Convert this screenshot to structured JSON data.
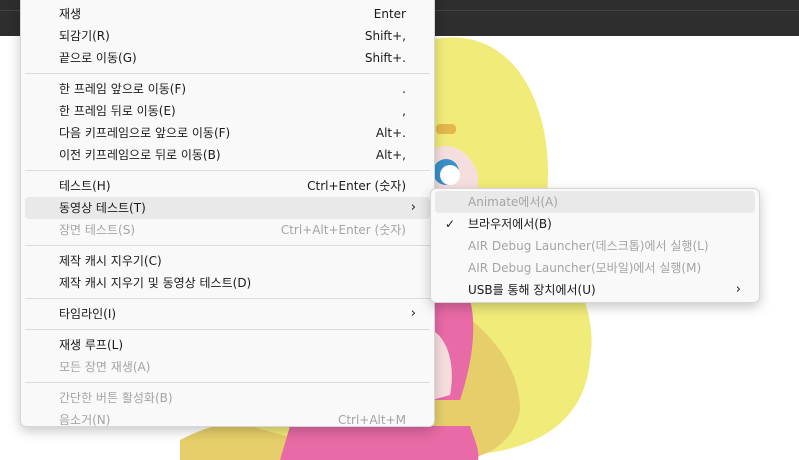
{
  "main_menu": {
    "groups": [
      [
        {
          "label": "재생",
          "shortcut": "Enter",
          "disabled": false
        },
        {
          "label": "되감기(R)",
          "shortcut": "Shift+,",
          "disabled": false
        },
        {
          "label": "끝으로 이동(G)",
          "shortcut": "Shift+.",
          "disabled": false
        }
      ],
      [
        {
          "label": "한 프레임 앞으로 이동(F)",
          "shortcut": ".",
          "disabled": false
        },
        {
          "label": "한 프레임 뒤로 이동(E)",
          "shortcut": ",",
          "disabled": false
        },
        {
          "label": "다음 키프레임으로 앞으로 이동(F)",
          "shortcut": "Alt+.",
          "disabled": false
        },
        {
          "label": "이전 키프레임으로 뒤로 이동(B)",
          "shortcut": "Alt+,",
          "disabled": false
        }
      ],
      [
        {
          "label": "테스트(H)",
          "shortcut": "Ctrl+Enter (숫자)",
          "disabled": false
        },
        {
          "label": "동영상 테스트(T)",
          "shortcut": "",
          "submenu": true,
          "active": true,
          "disabled": false
        },
        {
          "label": "장면 테스트(S)",
          "shortcut": "Ctrl+Alt+Enter (숫자)",
          "disabled": true
        }
      ],
      [
        {
          "label": "제작 캐시 지우기(C)",
          "shortcut": "",
          "disabled": false
        },
        {
          "label": "제작 캐시 지우기 및 동영상 테스트(D)",
          "shortcut": "",
          "disabled": false
        }
      ],
      [
        {
          "label": "타임라인(I)",
          "shortcut": "",
          "submenu": true,
          "disabled": false
        }
      ],
      [
        {
          "label": "재생 루프(L)",
          "shortcut": "",
          "disabled": false
        },
        {
          "label": "모든 장면 재생(A)",
          "shortcut": "",
          "disabled": true
        }
      ],
      [
        {
          "label": "간단한 버튼 활성화(B)",
          "shortcut": "",
          "disabled": true
        },
        {
          "label": "음소거(N)",
          "shortcut": "Ctrl+Alt+M",
          "disabled": true
        }
      ]
    ]
  },
  "sub_menu": {
    "items": [
      {
        "label": "Animate에서(A)",
        "disabled": true,
        "active": true,
        "checked": false
      },
      {
        "label": "브라우저에서(B)",
        "disabled": false,
        "checked": true
      },
      {
        "label": "AIR Debug Launcher(데스크톱)에서 실행(L)",
        "disabled": true,
        "checked": false
      },
      {
        "label": "AIR Debug Launcher(모바일)에서 실행(M)",
        "disabled": true,
        "checked": false
      },
      {
        "label": "USB를 통해 장치에서(U)",
        "disabled": false,
        "checked": false,
        "submenu": true
      }
    ]
  },
  "glyphs": {
    "submenu_arrow": "›",
    "check": "✓"
  },
  "colors": {
    "hair": "#f1ec7a",
    "hair_shadow": "#e6cf6a",
    "dress": "#e86aa6",
    "skin": "#f7dede",
    "eye": "#3a8fc9",
    "topbar": "#2e2e2e"
  }
}
